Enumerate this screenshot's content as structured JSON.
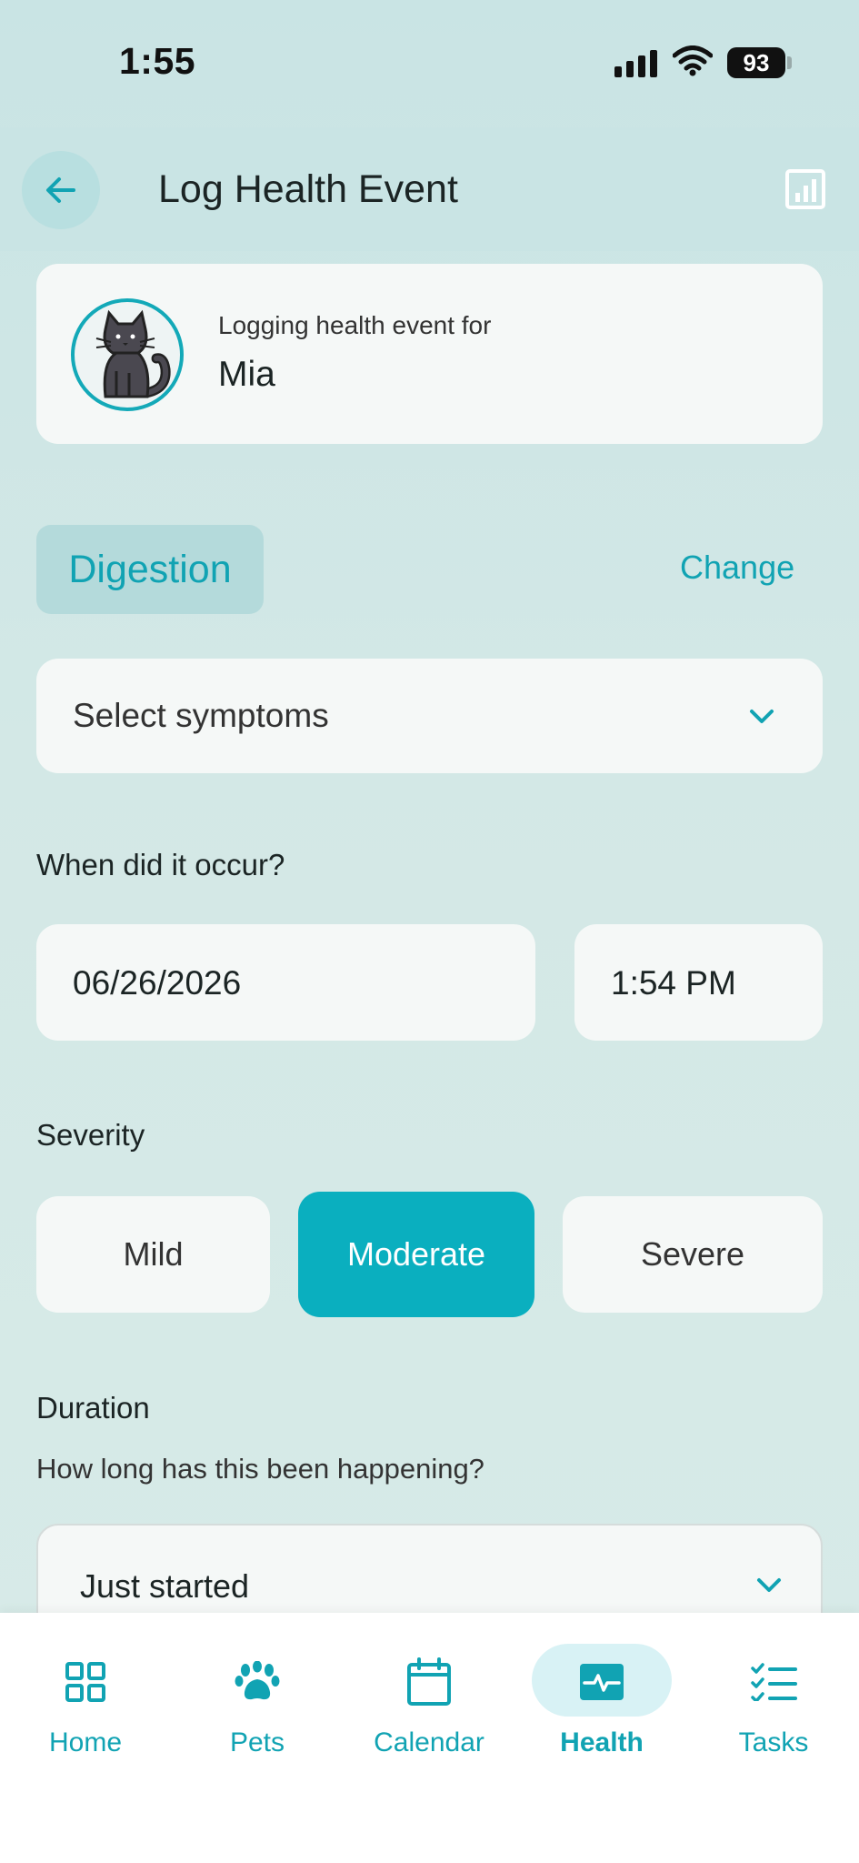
{
  "status_bar": {
    "time": "1:55",
    "battery": "93"
  },
  "header": {
    "title": "Log Health Event",
    "back_icon": "arrow-left-icon",
    "chart_icon": "bar-chart-icon"
  },
  "pet": {
    "subtitle": "Logging health event for",
    "name": "Mia"
  },
  "category": {
    "label": "Digestion",
    "change_label": "Change"
  },
  "symptoms": {
    "placeholder": "Select symptoms"
  },
  "occurrence": {
    "label": "When did it occur?",
    "date": "06/26/2026",
    "time": "1:54 PM"
  },
  "severity": {
    "label": "Severity",
    "options": [
      "Mild",
      "Moderate",
      "Severe"
    ],
    "selected": "Moderate"
  },
  "duration": {
    "label": "Duration",
    "hint": "How long has this been happening?",
    "value": "Just started"
  },
  "nav": {
    "items": [
      {
        "label": "Home",
        "icon": "grid-icon"
      },
      {
        "label": "Pets",
        "icon": "paw-icon"
      },
      {
        "label": "Calendar",
        "icon": "calendar-icon"
      },
      {
        "label": "Health",
        "icon": "pulse-icon"
      },
      {
        "label": "Tasks",
        "icon": "checklist-icon"
      }
    ],
    "active": "Health"
  },
  "colors": {
    "accent": "#0aafbf",
    "background": "#d3e8e6",
    "card": "#f5f8f7"
  }
}
